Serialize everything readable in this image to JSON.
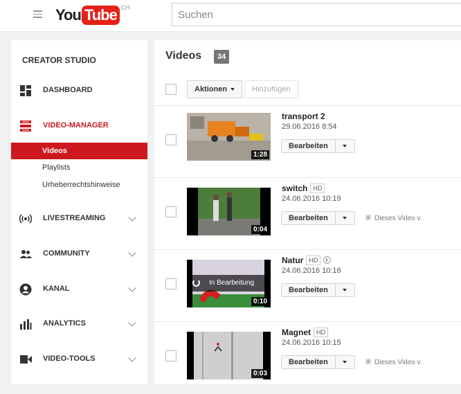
{
  "header": {
    "logo_you": "You",
    "logo_tube": "Tube",
    "logo_region": "CH",
    "search_placeholder": "Suchen"
  },
  "sidebar": {
    "title": "CREATOR STUDIO",
    "items": [
      {
        "label": "DASHBOARD",
        "icon": "dashboard-icon"
      },
      {
        "label": "VIDEO-MANAGER",
        "icon": "video-manager-icon",
        "active": true
      },
      {
        "label": "LIVESTREAMING",
        "icon": "livestream-icon"
      },
      {
        "label": "COMMUNITY",
        "icon": "community-icon"
      },
      {
        "label": "KANAL",
        "icon": "channel-icon"
      },
      {
        "label": "ANALYTICS",
        "icon": "analytics-icon"
      },
      {
        "label": "VIDEO-TOOLS",
        "icon": "video-tools-icon"
      }
    ],
    "subitems": [
      "Videos",
      "Playlists",
      "Urheberrechtshinweise"
    ],
    "active_color": "#cc181e"
  },
  "main": {
    "title": "Videos",
    "count": "34",
    "actions_label": "Aktionen",
    "add_label": "Hinzufügen",
    "edit_label": "Bearbeiten",
    "videos": [
      {
        "title": "transport 2",
        "date": "29.06.2016 8:54",
        "duration": "1:28",
        "hd": "",
        "note": ""
      },
      {
        "title": "switch",
        "date": "24.06.2016 10:19",
        "duration": "0:04",
        "hd": "HD",
        "note": "Dieses Video v"
      },
      {
        "title": "Natur",
        "date": "24.06.2016 10:16",
        "duration": "0:10",
        "hd": "HD",
        "note": "",
        "processing": "In Bearbeitung"
      },
      {
        "title": "Magnet",
        "date": "24.06.2016 10:15",
        "duration": "0:03",
        "hd": "HD",
        "note": "Dieses Video v"
      }
    ]
  }
}
